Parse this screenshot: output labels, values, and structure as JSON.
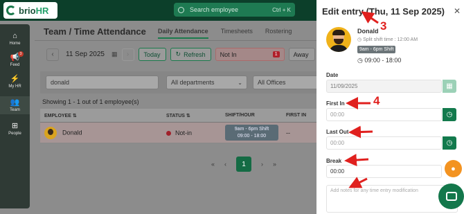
{
  "app": {
    "brand_main": "brio",
    "brand_accent": "HR"
  },
  "search": {
    "placeholder": "Search employee",
    "shortcut": "Ctrl + K"
  },
  "sidebar": {
    "items": [
      {
        "label": "Home",
        "icon": "home-icon"
      },
      {
        "label": "Feed",
        "icon": "megaphone-icon",
        "badge": "3"
      },
      {
        "label": "My HR",
        "icon": "bolt-icon"
      },
      {
        "label": "Team",
        "icon": "team-icon"
      },
      {
        "label": "People",
        "icon": "org-chart-icon"
      }
    ]
  },
  "header": {
    "breadcrumb": "Team / Time Attendance",
    "tabs": [
      "Daily Attendance",
      "Timesheets",
      "Rostering"
    ]
  },
  "controls": {
    "date": "11 Sep 2025",
    "today": "Today",
    "refresh": "Refresh",
    "not_in_label": "Not In",
    "not_in_count": "1",
    "away_label": "Away"
  },
  "filters": {
    "search_value": "donald",
    "departments": "All departments",
    "offices": "All Offices"
  },
  "table": {
    "summary": "Showing 1 - 1 out of 1 employee(s)",
    "headers": [
      "EMPLOYEE",
      "STATUS",
      "SHIFT/HOUR",
      "FIRST IN"
    ],
    "rows": [
      {
        "employee": "Donald",
        "status": "Not-in",
        "shift": "9am - 6pm Shift",
        "hours": "09:00 - 18:00",
        "first_in": "--"
      }
    ]
  },
  "pagination": {
    "current": "1",
    "first": "«",
    "prev": "‹",
    "next": "›",
    "last": "»"
  },
  "drawer": {
    "title": "Edit entry (Thu, 11 Sep 2025)",
    "name": "Donald",
    "split": "Split shift time : 12:00 AM",
    "shift": "9am - 6pm Shift",
    "hours": "09:00 - 18:00",
    "date_label": "Date",
    "date_value": "11/09/2025",
    "first_in_label": "First In",
    "first_in_placeholder": "00:00",
    "last_out_label": "Last Out",
    "last_out_placeholder": "00:00",
    "break_label": "Break",
    "break_value": "00:00",
    "notes_placeholder": "Add notes for any time entry modification"
  },
  "annotations": {
    "three": "3",
    "four": "4"
  },
  "colors": {
    "brand_green": "#137a4d",
    "annotation_red": "#e0201e",
    "fab_orange": "#f39321"
  }
}
